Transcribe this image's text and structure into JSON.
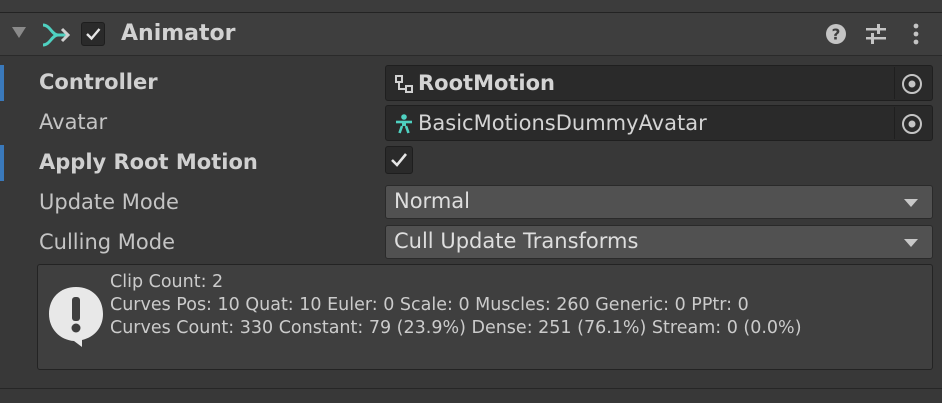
{
  "component": {
    "title": "Animator",
    "enabled": true,
    "icon": "animator-icon"
  },
  "header_buttons": [
    "help-icon",
    "preset-icon",
    "menu-icon"
  ],
  "fields": {
    "controller": {
      "label": "Controller",
      "value": "RootMotion",
      "icon": "animator-controller-icon",
      "modified": true
    },
    "avatar": {
      "label": "Avatar",
      "value": "BasicMotionsDummyAvatar",
      "icon": "avatar-icon"
    },
    "apply_root_motion": {
      "label": "Apply Root Motion",
      "checked": true,
      "modified": true
    },
    "update_mode": {
      "label": "Update Mode",
      "value": "Normal"
    },
    "culling_mode": {
      "label": "Culling Mode",
      "value": "Cull Update Transforms"
    }
  },
  "info_box": {
    "icon": "info-icon",
    "lines": [
      "Clip Count: 2",
      "Curves Pos: 10 Quat: 10 Euler: 0 Scale: 0 Muscles: 260 Generic: 0 PPtr: 0",
      "Curves Count: 330 Constant: 79 (23.9%) Dense: 251 (76.1%) Stream: 0 (0.0%)"
    ]
  },
  "colors": {
    "accent_modified": "#3a79bb",
    "teal_icon": "#4fd1c1",
    "background": "#383838"
  }
}
